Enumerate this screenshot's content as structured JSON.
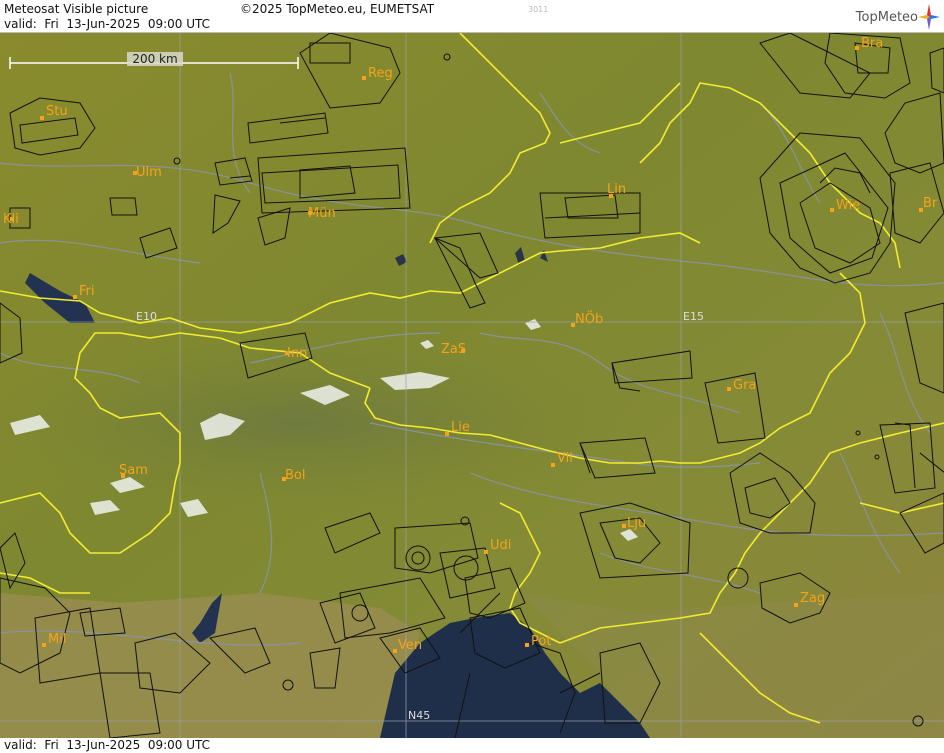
{
  "header": {
    "title": "Meteosat Visible picture",
    "copyright": "©2025 TopMeteo.eu, EUMETSAT",
    "valid": "valid:  Fri  13-Jun-2025  09:00 UTC",
    "code": "3011",
    "logo": "TopMeteo"
  },
  "footer": {
    "valid": "valid:  Fri  13-Jun-2025  09:00 UTC"
  },
  "map": {
    "scale_label": "200 km",
    "grid_labels": {
      "e10": "E10",
      "e15": "E15",
      "n45": "N45"
    },
    "cities": [
      {
        "key": "Reg",
        "label": "Reg"
      },
      {
        "key": "Bra",
        "label": "Bra"
      },
      {
        "key": "Stu",
        "label": "Stu"
      },
      {
        "key": "Ulm",
        "label": "Ulm"
      },
      {
        "key": "Mun",
        "label": "Mün"
      },
      {
        "key": "Kli",
        "label": "Kli"
      },
      {
        "key": "Lin",
        "label": "Lin"
      },
      {
        "key": "Wie",
        "label": "Wie"
      },
      {
        "key": "Br2",
        "label": "Br"
      },
      {
        "key": "Fri",
        "label": "Fri"
      },
      {
        "key": "Nob",
        "label": "NÖb"
      },
      {
        "key": "Inn",
        "label": "Inn"
      },
      {
        "key": "ZaS",
        "label": "ZaS"
      },
      {
        "key": "Gra",
        "label": "Gra"
      },
      {
        "key": "Lie",
        "label": "Lie"
      },
      {
        "key": "Vil",
        "label": "Vil"
      },
      {
        "key": "Sam",
        "label": "Sam"
      },
      {
        "key": "Bol",
        "label": "Bol"
      },
      {
        "key": "Lju",
        "label": "Lju"
      },
      {
        "key": "Udi",
        "label": "Udi"
      },
      {
        "key": "Zag",
        "label": "Zag"
      },
      {
        "key": "Mil",
        "label": "Mil"
      },
      {
        "key": "Ven",
        "label": "Ven"
      },
      {
        "key": "Pot",
        "label": "Pot"
      }
    ]
  }
}
